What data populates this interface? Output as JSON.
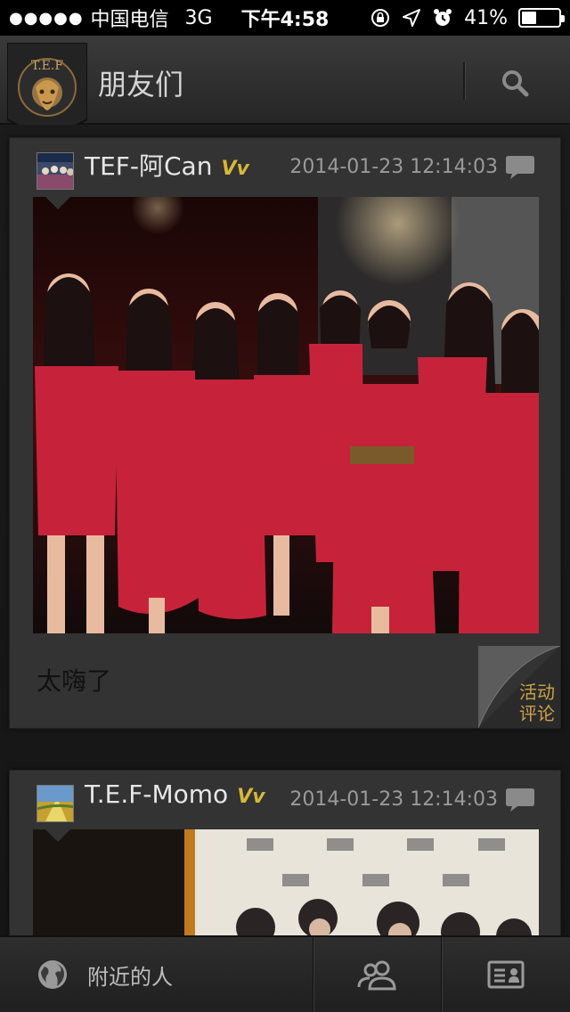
{
  "status_bar": {
    "signal": "●●●●●",
    "carrier": "中国电信",
    "network": "3G",
    "time": "下午4:58",
    "battery_text": "41%",
    "battery_level": 0.41
  },
  "header": {
    "logo_text": "T.E.F",
    "title": "朋友们",
    "search_icon": "search-icon"
  },
  "posts": [
    {
      "username": "TEF-阿Can",
      "vip": "Vv",
      "timestamp": "2014-01-23 12:14:03",
      "text": "太嗨了",
      "tag_line1": "活动",
      "tag_line2": "评论"
    },
    {
      "username": "T.E.F-Momo",
      "vip": "Vv",
      "timestamp": "2014-01-23 12:14:03"
    }
  ],
  "tabbar": {
    "nearby_label": "附近的人",
    "nearby_icon": "globe-icon",
    "friends_icon": "people-icon",
    "card_icon": "id-card-icon"
  },
  "colors": {
    "accent_gold": "#d7b73a",
    "curl_text": "#c9a24a",
    "background": "#141414"
  }
}
